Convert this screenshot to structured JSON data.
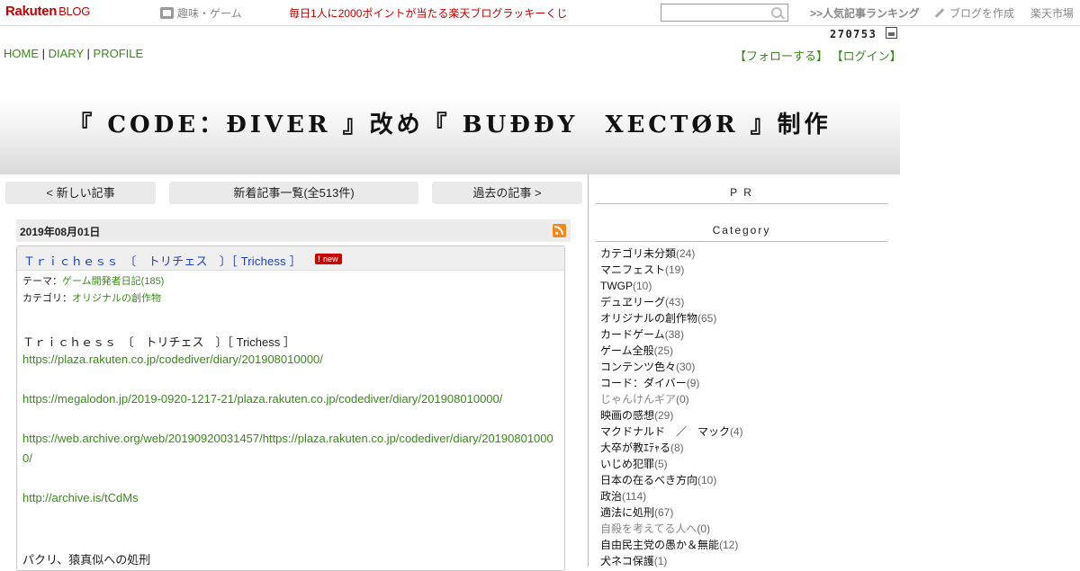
{
  "topbar": {
    "logo": "Rakuten",
    "logo_sub": "BLOG",
    "hobby": "趣味・ゲーム",
    "lucky": "毎日1人に2000ポイントが当たる楽天ブログラッキーくじ",
    "search_placeholder": "",
    "ranking": ">>人気記事ランキング",
    "create": "ブログを作成",
    "market": "楽天市場"
  },
  "counter": "270753",
  "nav": {
    "home": "HOME",
    "diary": "DIARY",
    "profile": "PROFILE",
    "sep": "|",
    "follow": "【フォローする】",
    "login": "【ログイン】"
  },
  "blog_title": "『 CODE：ĐIVER 』改め『 BUĐĐY　XECTØR 』制作",
  "pager": {
    "newer": "< 新しい記事",
    "list": "新着記事一覧(全513件)",
    "older": "過去の記事 >"
  },
  "entry": {
    "date": "2019年08月01日",
    "title": "Ｔｒｉｃｈｅｓｓ　〔　トリチェス　〕［ Trichess ］",
    "badge": "new",
    "theme_label": "テーマ：",
    "theme": "ゲーム開発者日記(185)",
    "category_label": "カテゴリ：",
    "category": "オリジナルの創作物",
    "body_title": "Ｔｒｉｃｈｅｓｓ　〔　トリチェス　〕［ Trichess ］",
    "link1": "https://plaza.rakuten.co.jp/codediver/diary/201908010000/",
    "link2": "https://megalodon.jp/2019-0920-1217-21/plaza.rakuten.co.jp/codediver/diary/201908010000/",
    "link3a": "https://web.archive.org/web/20190920031457/https://plaza.rakuten.co.jp/codediver/diary/20190801000",
    "link3b": "0/",
    "link4": "http://archive.is/tCdMs",
    "tail": "パクリ、猿真似への処刑"
  },
  "sidebar": {
    "pr": "P R",
    "category_head": "Category",
    "categories": [
      {
        "name": "カテゴリ未分類",
        "count": "(24)",
        "dim": false
      },
      {
        "name": "マニフェスト",
        "count": "(19)",
        "dim": false
      },
      {
        "name": "TWGP",
        "count": "(10)",
        "dim": false
      },
      {
        "name": "デュヱリーグ",
        "count": "(43)",
        "dim": false
      },
      {
        "name": "オリジナルの創作物",
        "count": "(65)",
        "dim": false
      },
      {
        "name": "カードゲーム",
        "count": "(38)",
        "dim": false
      },
      {
        "name": "ゲーム全般",
        "count": "(25)",
        "dim": false
      },
      {
        "name": "コンテンツ色々",
        "count": "(30)",
        "dim": false
      },
      {
        "name": "コード：ダイバー",
        "count": "(9)",
        "dim": false
      },
      {
        "name": "じゃんけんギア",
        "count": "(0)",
        "dim": true
      },
      {
        "name": "映画の感想",
        "count": "(29)",
        "dim": false
      },
      {
        "name": "マクドナルド　／　マック",
        "count": "(4)",
        "dim": false
      },
      {
        "name": "大卒が教ｴﾃｬる",
        "count": "(8)",
        "dim": false
      },
      {
        "name": "いじめ犯罪",
        "count": "(5)",
        "dim": false
      },
      {
        "name": "日本の在るべき方向",
        "count": "(10)",
        "dim": false
      },
      {
        "name": "政治",
        "count": "(114)",
        "dim": false
      },
      {
        "name": "適法に処刑",
        "count": "(67)",
        "dim": false
      },
      {
        "name": "自殺を考えてる人へ",
        "count": "(0)",
        "dim": true
      },
      {
        "name": "自由民主党の愚か＆無能",
        "count": "(12)",
        "dim": false
      },
      {
        "name": "犬ネコ保護",
        "count": "(1)",
        "dim": false
      }
    ]
  }
}
